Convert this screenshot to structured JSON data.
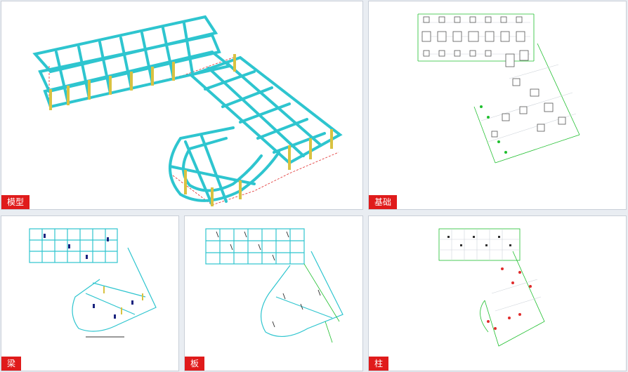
{
  "panels": {
    "model": {
      "label": "模型"
    },
    "foundation": {
      "label": "基础"
    },
    "beam": {
      "label": "梁"
    },
    "slab": {
      "label": "板"
    },
    "column": {
      "label": "柱"
    }
  },
  "colors": {
    "beam_cyan": "#2ec5cf",
    "column_yellow": "#d9c241",
    "grid_green": "#1fbf2e",
    "dim_red": "#e02b2b",
    "tag_red": "#e01b1b"
  }
}
